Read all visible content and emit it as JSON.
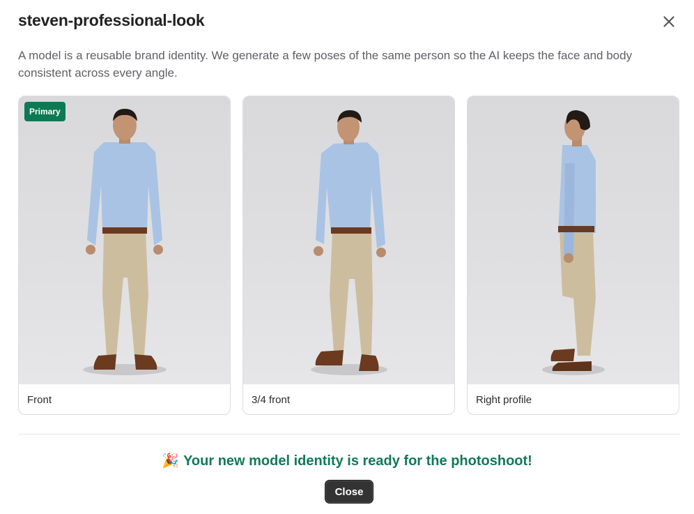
{
  "modal": {
    "title": "steven-professional-look",
    "description": "A model is a reusable brand identity. We generate a few poses of the same person so the AI keeps the face and body consistent across every angle.",
    "close_icon": "close-icon"
  },
  "poses": [
    {
      "label": "Front",
      "badge": "Primary"
    },
    {
      "label": "3/4 front",
      "badge": ""
    },
    {
      "label": "Right profile",
      "badge": ""
    }
  ],
  "footer": {
    "emoji": "🎉",
    "success_message": "Your new model identity is ready for the photoshoot!",
    "close_button": "Close"
  },
  "colors": {
    "accent_green": "#117a57",
    "badge_green": "#0d7a53",
    "button_dark": "#333333"
  }
}
